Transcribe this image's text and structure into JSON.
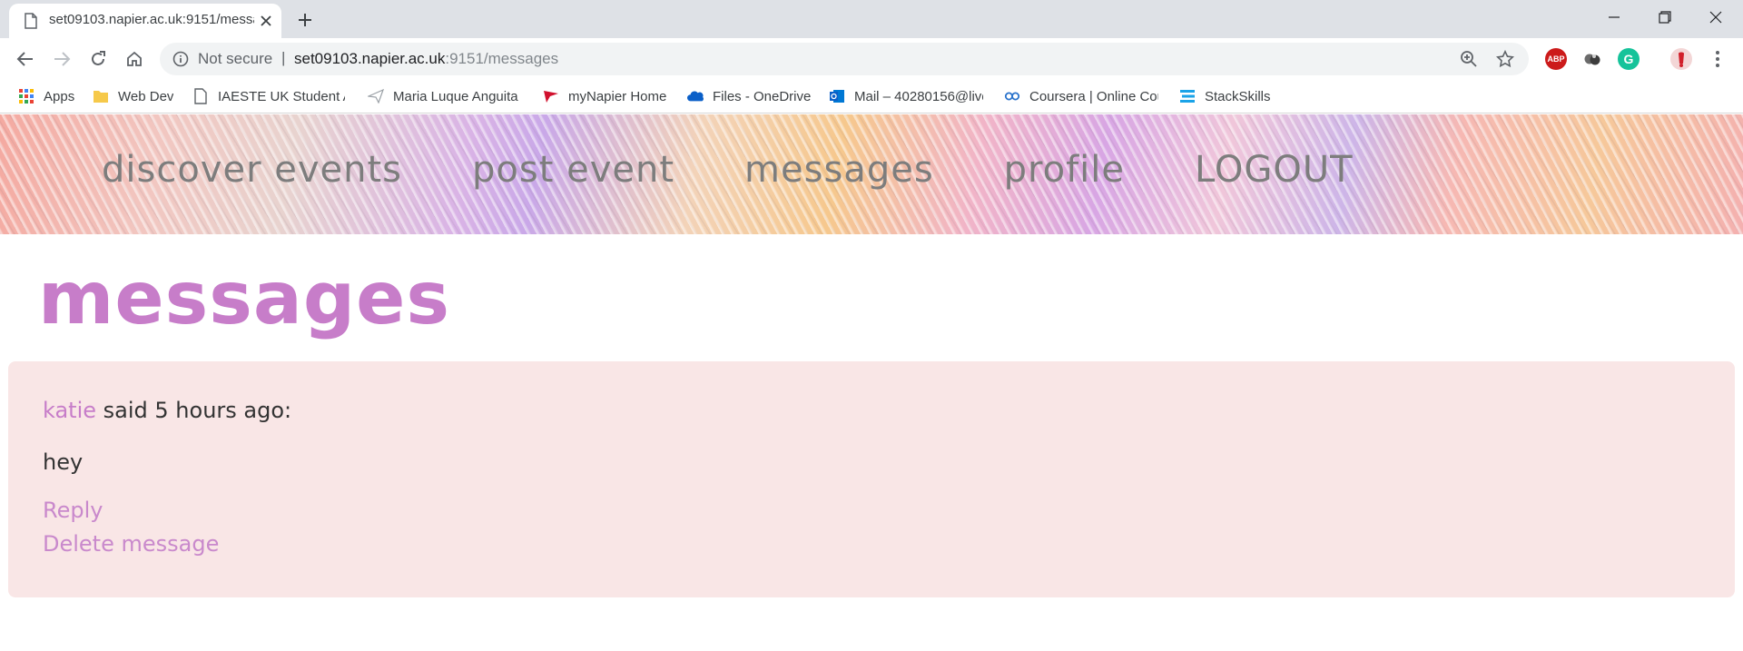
{
  "browser": {
    "tab": {
      "title": "set09103.napier.ac.uk:9151/messages"
    },
    "address_bar": {
      "security_label": "Not secure",
      "separator": "|",
      "url_host": "set09103.napier.ac.uk",
      "url_rest": ":9151/messages"
    },
    "extensions": {
      "abp_label": "ABP",
      "grammarly_label": "G"
    },
    "bookmarks": [
      {
        "label": "Apps",
        "icon": "apps-grid-icon"
      },
      {
        "label": "Web Dev",
        "icon": "folder-icon"
      },
      {
        "label": "IAESTE UK Student Ap",
        "icon": "page-icon"
      },
      {
        "label": "Maria Luque Anguita",
        "icon": "paper-plane-icon"
      },
      {
        "label": "myNapier Home",
        "icon": "napier-flag-icon"
      },
      {
        "label": "Files - OneDrive",
        "icon": "onedrive-cloud-icon"
      },
      {
        "label": "Mail – 40280156@live",
        "icon": "outlook-icon"
      },
      {
        "label": "Coursera | Online Cou",
        "icon": "coursera-icon"
      },
      {
        "label": "StackSkills",
        "icon": "stackskills-icon"
      }
    ]
  },
  "site": {
    "nav": [
      {
        "label": "discover events",
        "key": "discover"
      },
      {
        "label": "post event",
        "key": "post"
      },
      {
        "label": "messages",
        "key": "messages"
      },
      {
        "label": "profile",
        "key": "profile"
      },
      {
        "label": "LOGOUT",
        "key": "logout"
      }
    ],
    "page_title": "Messages",
    "messages": [
      {
        "author": "katie",
        "meta_suffix": " said 5 hours ago:",
        "body": "hey",
        "reply_label": "Reply",
        "delete_label": "Delete message"
      }
    ]
  },
  "colors": {
    "accent": "#c77dc9",
    "card_background": "#f9e6e6",
    "nav_text": "#7d7d7d",
    "text": "#333333"
  }
}
